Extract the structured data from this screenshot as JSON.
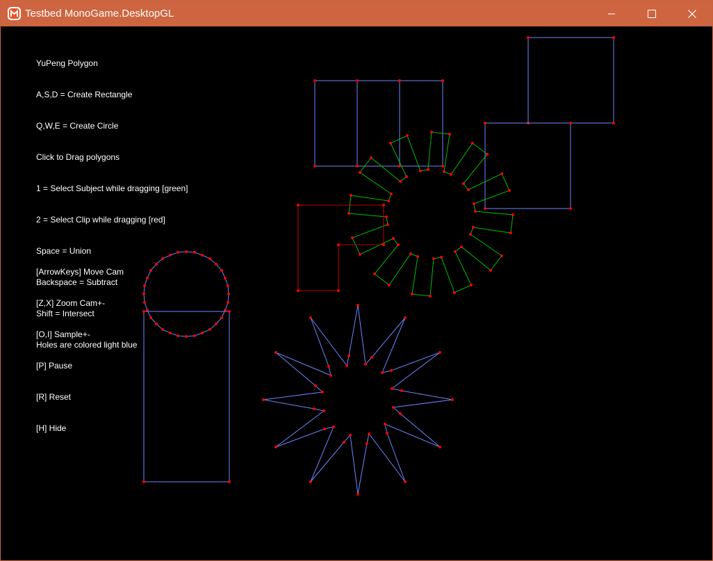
{
  "window": {
    "title": "Testbed MonoGame.DesktopGL",
    "icon": "monogame-logo-icon",
    "controls": [
      "minimize-icon",
      "maximize-icon",
      "close-icon"
    ],
    "colors": {
      "titlebar": "#cd6540",
      "background": "#000000",
      "subject_outline": "#00c000",
      "clip_outline": "#c00000",
      "result_outline": "#6f86ff",
      "vertex": "#ff0000"
    }
  },
  "hud": {
    "instructions": [
      "YuPeng Polygon",
      "A,S,D = Create Rectangle",
      "Q,W,E = Create Circle",
      "Click to Drag polygons",
      "1 = Select Subject while dragging [green]",
      "2 = Select Clip while dragging [red]",
      "Space = Union",
      "Backspace = Subtract",
      "Shift = Intersect",
      "Holes are colored light blue"
    ],
    "controls": [
      "[ArrowKeys] Move Cam",
      "[Z,X] Zoom Cam+-",
      "[O,I] Sample+-",
      "[P] Pause",
      "[R] Reset",
      "[H] Hide"
    ]
  }
}
